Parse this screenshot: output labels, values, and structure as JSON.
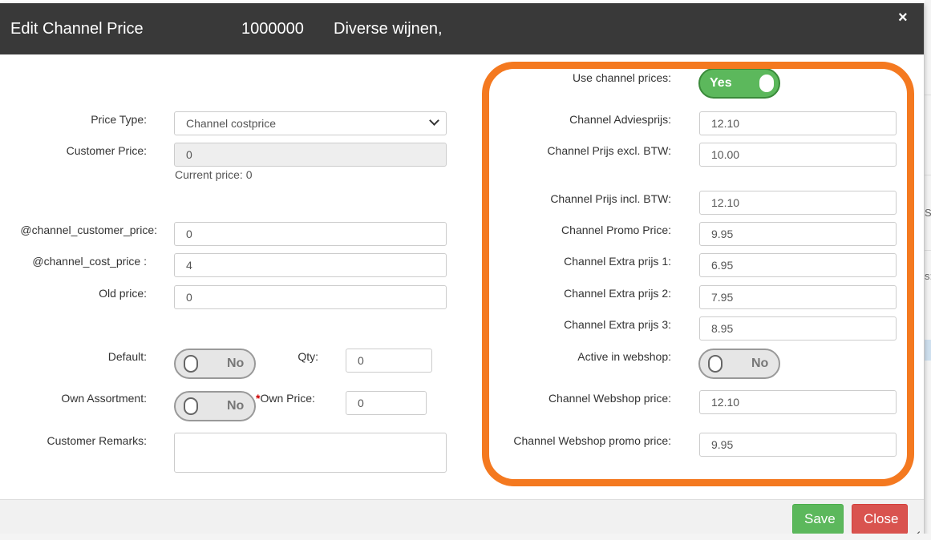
{
  "header": {
    "title": "Edit Channel Price",
    "code": "1000000",
    "description": "Diverse wijnen,",
    "close_glyph": "×"
  },
  "left": {
    "price_type_label": "Price Type:",
    "price_type_value": "Channel costprice",
    "customer_price_label": "Customer Price:",
    "customer_price_value": "0",
    "current_price_text": "Current price: 0",
    "channel_customer_price_label": "@channel_customer_price:",
    "channel_customer_price_value": "0",
    "channel_cost_price_label": "@channel_cost_price :",
    "channel_cost_price_value": "4",
    "old_price_label": "Old price:",
    "old_price_value": "0",
    "default_label": "Default:",
    "default_toggle": "No",
    "qty_label": "Qty:",
    "qty_value": "0",
    "own_assortment_label": "Own Assortment:",
    "own_assortment_toggle": "No",
    "own_price_required": "*",
    "own_price_label": "Own Price:",
    "own_price_value": "0",
    "customer_remarks_label": "Customer Remarks:",
    "customer_remarks_value": ""
  },
  "right": {
    "use_channel_prices_label": "Use channel prices:",
    "use_channel_prices_toggle": "Yes",
    "adviesprijs_label": "Channel Adviesprijs:",
    "adviesprijs_value": "12.10",
    "prijs_excl_label": "Channel Prijs excl. BTW:",
    "prijs_excl_value": "10.00",
    "prijs_incl_label": "Channel Prijs incl. BTW:",
    "prijs_incl_value": "12.10",
    "promo_label": "Channel Promo Price:",
    "promo_value": "9.95",
    "extra1_label": "Channel Extra prijs 1:",
    "extra1_value": "6.95",
    "extra2_label": "Channel Extra prijs 2:",
    "extra2_value": "7.95",
    "extra3_label": "Channel Extra prijs 3:",
    "extra3_value": "8.95",
    "active_webshop_label": "Active in webshop:",
    "active_webshop_toggle": "No",
    "webshop_price_label": "Channel Webshop price:",
    "webshop_price_value": "12.10",
    "webshop_promo_label": "Channel Webshop promo price:",
    "webshop_promo_value": "9.95"
  },
  "footer": {
    "save_label": "Save",
    "close_label": "Close"
  },
  "background": {
    "right_text_1": "Se",
    "right_text_2": "s:"
  },
  "colors": {
    "header_bg": "#393939",
    "highlight": "#f47920",
    "save": "#5cb85c",
    "close": "#d9534f"
  }
}
